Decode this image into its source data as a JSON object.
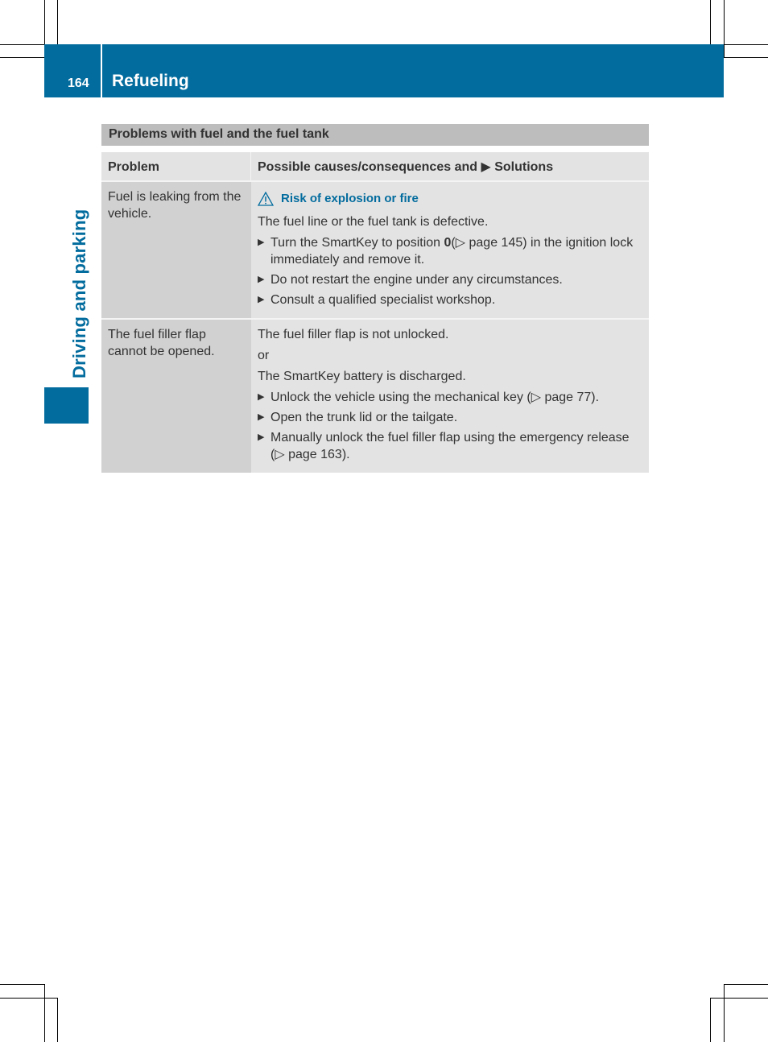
{
  "header": {
    "page_number": "164",
    "chapter_title": "Refueling"
  },
  "side_tab": {
    "label": "Driving and parking"
  },
  "table": {
    "title": "Problems with fuel and the fuel tank",
    "columns": [
      "Problem",
      "Possible causes/consequences and ▶ Solutions"
    ],
    "rows": [
      {
        "problem": "Fuel is leaking from the vehicle.",
        "warning": {
          "icon": "warning-triangle-icon",
          "text": "Risk of explosion or fire"
        },
        "causes": [
          "The fuel line or the fuel tank is defective."
        ],
        "steps": [
          {
            "pre": "Turn the SmartKey to position ",
            "bold": "0",
            "post": "(▷ page 145) in the ignition lock immediately and remove it."
          },
          {
            "text": "Do not restart the engine under any circumstances."
          },
          {
            "text": "Consult a qualified specialist workshop."
          }
        ]
      },
      {
        "problem": "The fuel filler flap cannot be opened.",
        "causes": [
          "The fuel filler flap is not unlocked.",
          "or",
          "The SmartKey battery is discharged."
        ],
        "steps": [
          {
            "text": "Unlock the vehicle using the mechanical key (▷ page 77)."
          },
          {
            "text": "Open the trunk lid or the tailgate."
          },
          {
            "text": "Manually unlock the fuel filler flap using the emergency release (▷ page 163)."
          }
        ]
      }
    ]
  },
  "colors": {
    "brand_blue": "#036c9e",
    "title_bar_gray": "#bdbdbd",
    "problem_cell_gray": "#d1d1d1",
    "solution_cell_gray": "#e3e3e3"
  }
}
